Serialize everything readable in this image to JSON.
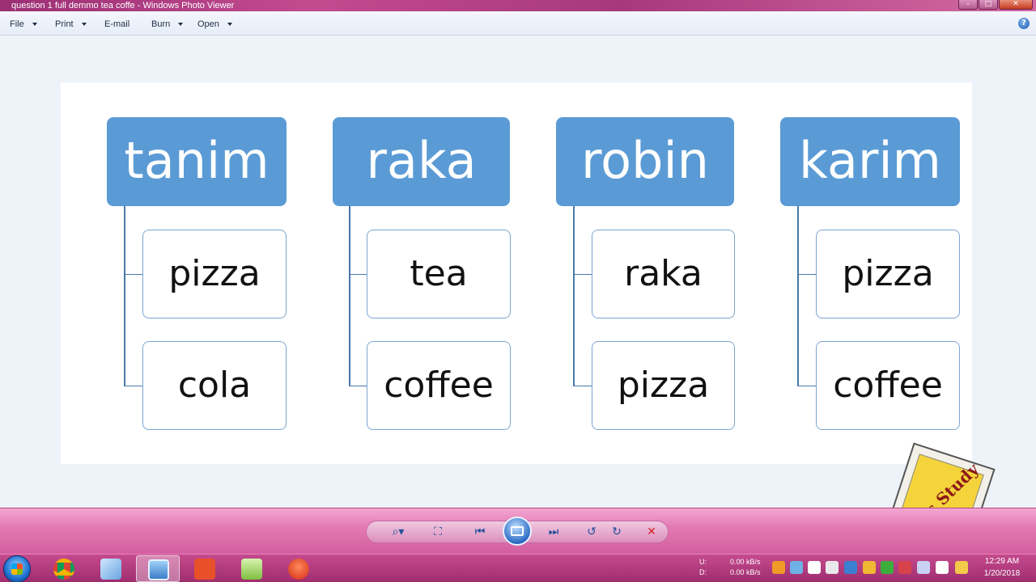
{
  "window": {
    "title": "question 1 full demmo tea coffe - Windows Photo Viewer",
    "min": "–",
    "max": "□",
    "close": "✕"
  },
  "menu": {
    "file": "File",
    "print": "Print",
    "email": "E-mail",
    "burn": "Burn",
    "open": "Open"
  },
  "help_icon": "help-icon",
  "diagram": {
    "groups": [
      {
        "name": "tanim",
        "items": [
          "pizza",
          "cola"
        ]
      },
      {
        "name": "raka",
        "items": [
          "tea",
          "coffee"
        ]
      },
      {
        "name": "robin",
        "items": [
          "raka",
          "pizza"
        ]
      },
      {
        "name": "karim",
        "items": [
          "pizza",
          "coffee"
        ]
      }
    ],
    "header_color": "#5b9bd5"
  },
  "watermark_text": "Let's Study",
  "controls": {
    "zoom": "⌕▾",
    "fit": "⛶",
    "previous": "⏮",
    "next": "⏭",
    "rotate_ccw": "↺",
    "rotate_cw": "↻",
    "delete": "✕"
  },
  "taskbar": {
    "upload_label": "U:",
    "download_label": "D:",
    "upload_speed": "0.00 kB/s",
    "download_speed": "0.00 kB/s",
    "time": "12:29 AM",
    "date": "1/20/2018"
  }
}
